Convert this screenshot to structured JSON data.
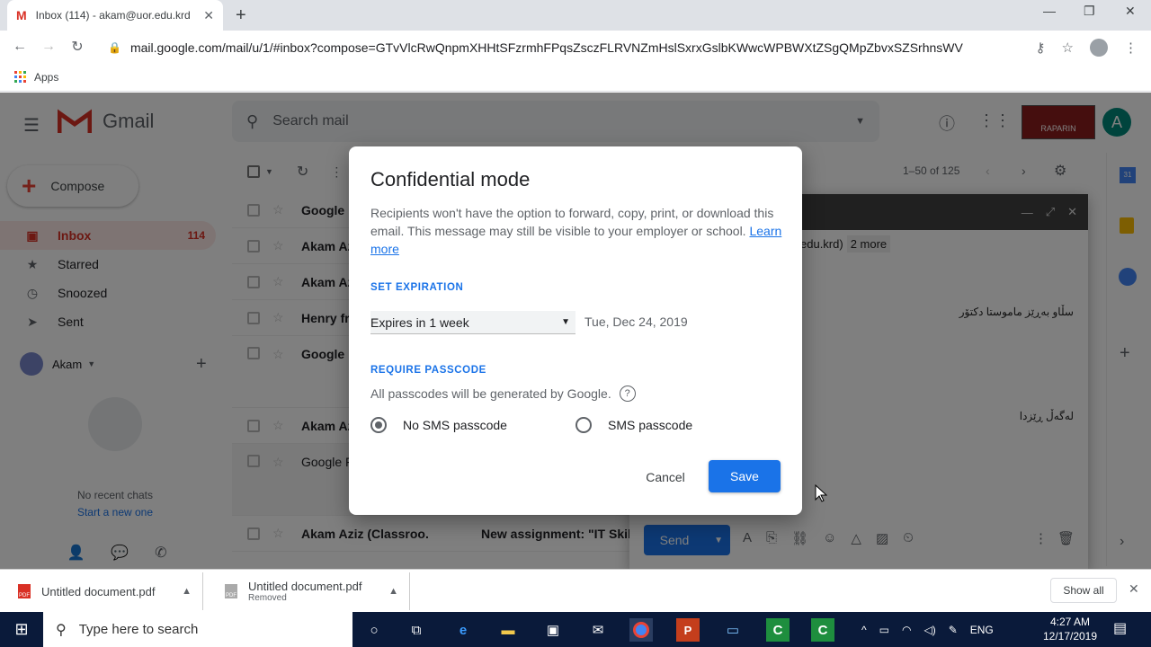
{
  "browser": {
    "tab_title": "Inbox (114) - akam@uor.edu.krd",
    "tab_icon": "M",
    "url": "mail.google.com/mail/u/1/#inbox?compose=GTvVlcRwQnpmXHHtSFzrmhFPqsZsczFLRVNZmHslSxrxGslbKWwcWPBWXtZSgQMpZbvxSZSrhnsWV",
    "bookmark_apps": "Apps"
  },
  "gmail": {
    "logo_text": "Gmail",
    "search_placeholder": "Search mail",
    "avatar_letter": "A",
    "brand_text": "RAPARIN",
    "compose_label": "Compose",
    "nav": [
      {
        "label": "Inbox",
        "count": "114",
        "icon": "inbox-icon"
      },
      {
        "label": "Starred",
        "count": "",
        "icon": "star-icon"
      },
      {
        "label": "Snoozed",
        "count": "",
        "icon": "clock-icon"
      },
      {
        "label": "Sent",
        "count": "",
        "icon": "send-icon"
      }
    ],
    "account_name": "Akam",
    "no_chats": "No recent chats",
    "start_chat": "Start a new one",
    "pager": "1–50 of 125",
    "rows": [
      {
        "sender": "Google",
        "subject": ""
      },
      {
        "sender": "Akam Aziz",
        "subject": ""
      },
      {
        "sender": "Akam Aziz",
        "subject": ""
      },
      {
        "sender": "Henry fro",
        "subject": ""
      },
      {
        "sender": "Google F",
        "subject": ""
      },
      {
        "sender": "Akam Aziz",
        "subject": ""
      },
      {
        "sender": "Google F",
        "subject": ""
      },
      {
        "sender": "Akam Aziz (Classroo.",
        "subject": "New assignment: \"IT Skills"
      }
    ],
    "compose_window": {
      "to_tail": "edu.krd)",
      "more": "2 more",
      "body_line1": "سڵاو بەڕێز ماموستا دکتۆر",
      "body_line2": "لەگەڵ ڕێزدا",
      "send_label": "Send"
    }
  },
  "dialog": {
    "title": "Confidential mode",
    "description": "Recipients won't have the option to forward, copy, print, or download this email. This message may still be visible to your employer or school.",
    "learn_more": "Learn more",
    "set_expiration_label": "SET EXPIRATION",
    "expiration_value": "Expires in 1 week",
    "expiration_date": "Tue, Dec 24, 2019",
    "require_passcode_label": "REQUIRE PASSCODE",
    "passcode_info": "All passcodes will be generated by Google.",
    "radio_no_sms": "No SMS passcode",
    "radio_sms": "SMS passcode",
    "selected_option": "No SMS passcode",
    "cancel_label": "Cancel",
    "save_label": "Save"
  },
  "downloads": {
    "items": [
      {
        "name": "Untitled document.pdf",
        "status": ""
      },
      {
        "name": "Untitled document.pdf",
        "status": "Removed"
      }
    ],
    "show_all": "Show all"
  },
  "taskbar": {
    "search_placeholder": "Type here to search",
    "language": "ENG",
    "time": "4:27 AM",
    "date": "12/17/2019"
  },
  "colors": {
    "accent": "#1a73e8",
    "gmail_red": "#d93025",
    "taskbar": "#0a1a3a"
  }
}
